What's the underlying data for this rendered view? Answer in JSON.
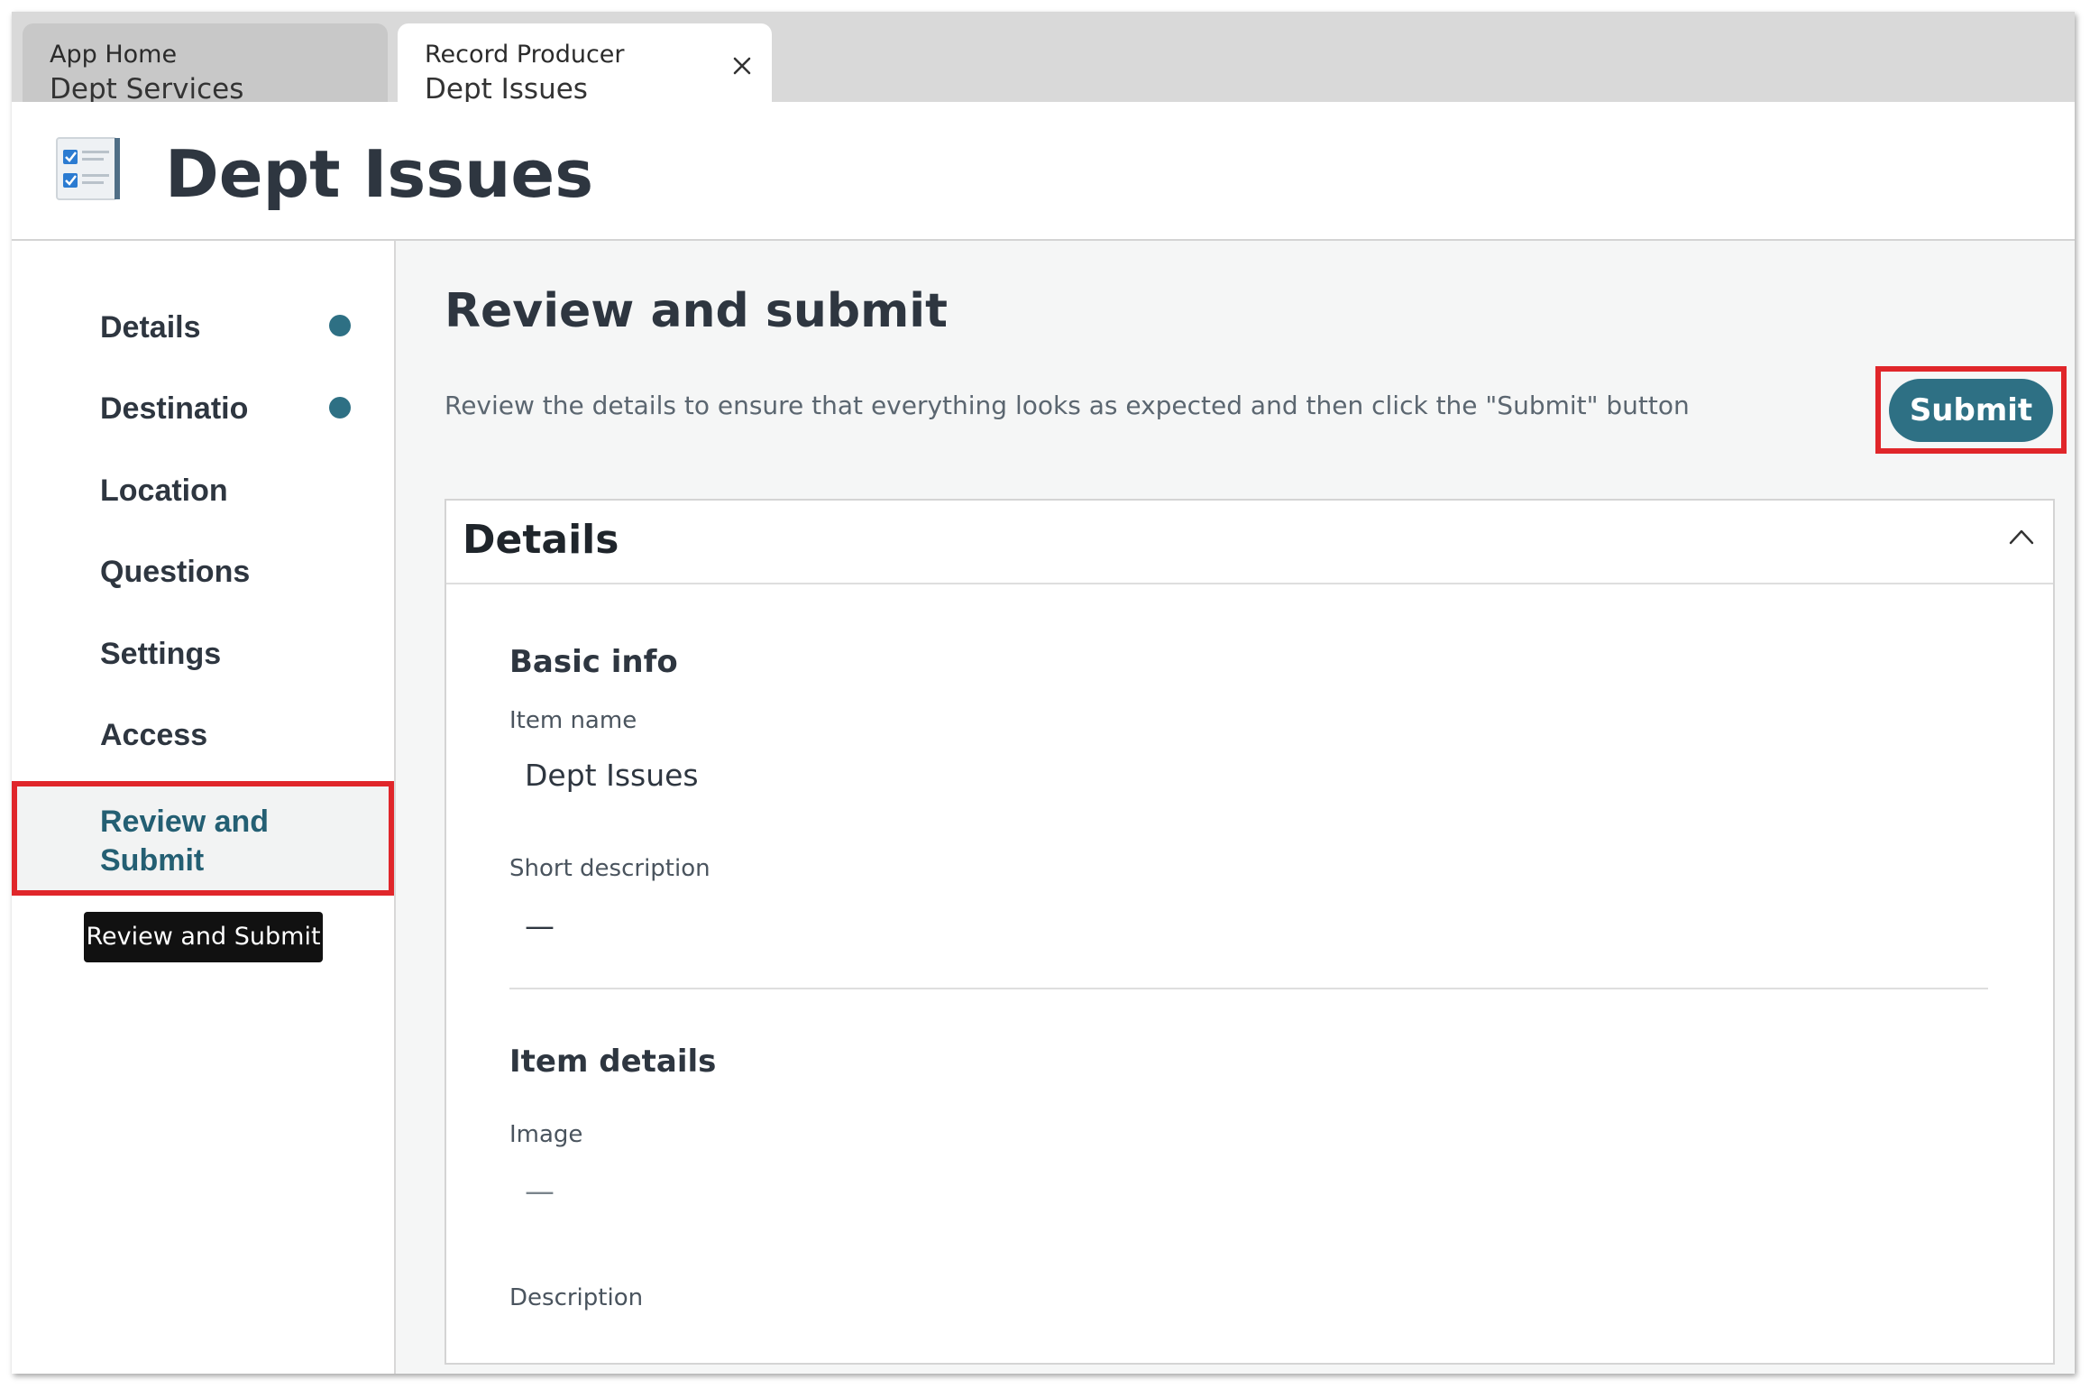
{
  "tabs": [
    {
      "kicker": "App Home",
      "title": "Dept Services"
    },
    {
      "kicker": "Record Producer",
      "title": "Dept Issues"
    }
  ],
  "header": {
    "title": "Dept Issues",
    "icon": "checklist-icon"
  },
  "sidebar": {
    "items": [
      {
        "label": "Details",
        "completed": true
      },
      {
        "label": "Destinatio",
        "completed": true
      },
      {
        "label": "Location",
        "completed": false
      },
      {
        "label": "Questions",
        "completed": false
      },
      {
        "label": "Settings",
        "completed": false
      },
      {
        "label": "Access",
        "completed": false
      },
      {
        "label": "Review and Submit",
        "completed": false,
        "active": true
      }
    ],
    "tooltip": "Review and Submit"
  },
  "main": {
    "title": "Review and submit",
    "description": "Review the details to ensure that everything looks as expected and then click the \"Submit\" button",
    "submit_label": "Submit",
    "panel": {
      "title": "Details",
      "basic_info": {
        "heading": "Basic info",
        "item_name_label": "Item name",
        "item_name_value": "Dept Issues",
        "short_description_label": "Short description",
        "short_description_value": "—"
      },
      "item_details": {
        "heading": "Item details",
        "image_label": "Image",
        "image_value": "—",
        "description_label": "Description"
      }
    }
  },
  "colors": {
    "accent": "#2e7084",
    "highlight": "#e0262a",
    "active_nav_text": "#245f73"
  }
}
